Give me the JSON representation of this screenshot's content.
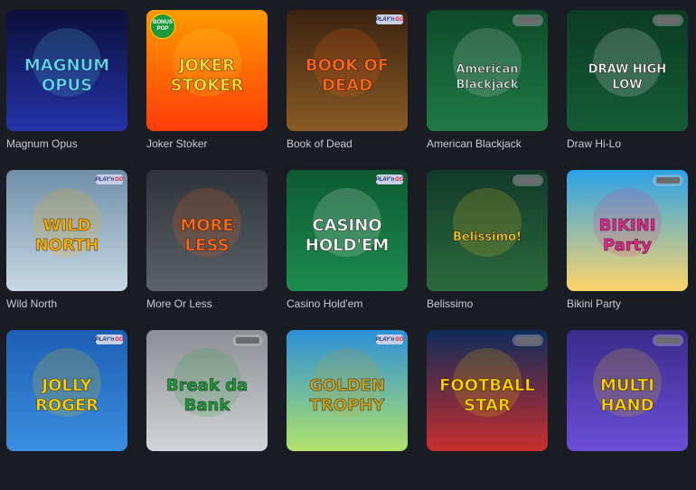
{
  "games": [
    {
      "title": "Magnum Opus",
      "art": "MAGNUM OPUS",
      "colors": [
        "#0b0f3a",
        "#2433a8"
      ],
      "accent": "#5fd7ff",
      "provider": "none"
    },
    {
      "title": "Joker Stoker",
      "art": "JOKER STOKER",
      "colors": [
        "#ff9a00",
        "#ff3b0a"
      ],
      "accent": "#ffde33",
      "provider": "bonus-pop"
    },
    {
      "title": "Book of Dead",
      "art": "BOOK OF DEAD",
      "colors": [
        "#3a2210",
        "#8a5b24"
      ],
      "accent": "#ff6a1a",
      "provider": "playngo"
    },
    {
      "title": "American Blackjack",
      "art": "American Blackjack",
      "colors": [
        "#0d4a2a",
        "#1f7a46"
      ],
      "accent": "#d9e8dc",
      "provider": "grey"
    },
    {
      "title": "Draw Hi-Lo",
      "art": "DRAW HIGH LOW",
      "colors": [
        "#0c3b24",
        "#145c36"
      ],
      "accent": "#ffffff",
      "provider": "grey"
    },
    {
      "title": "Wild North",
      "art": "WILD NORTH",
      "colors": [
        "#6f8fa8",
        "#c7d8e4"
      ],
      "accent": "#ffb000",
      "provider": "playngo"
    },
    {
      "title": "More Or Less",
      "art": "MORE LESS",
      "colors": [
        "#2e3338",
        "#5b6268"
      ],
      "accent": "#ff6b1a",
      "provider": "none"
    },
    {
      "title": "Casino Hold'em",
      "art": "CASINO HOLD'EM",
      "colors": [
        "#0d5a32",
        "#1c8c4e"
      ],
      "accent": "#ffffff",
      "provider": "playngo"
    },
    {
      "title": "Belissimo",
      "art": "Belissimo!",
      "colors": [
        "#123a2a",
        "#2b6a3c"
      ],
      "accent": "#ffd230",
      "provider": "grey"
    },
    {
      "title": "Bikini Party",
      "art": "BIKINI Party",
      "colors": [
        "#2aa2e8",
        "#ffd56b"
      ],
      "accent": "#e8268f",
      "provider": "grey"
    },
    {
      "title": "",
      "art": "JOLLY ROGER",
      "colors": [
        "#1d5fb5",
        "#3a8ee0"
      ],
      "accent": "#ffd200",
      "provider": "playngo"
    },
    {
      "title": "",
      "art": "Break da Bank",
      "colors": [
        "#8a8f94",
        "#d3d6d8"
      ],
      "accent": "#1f9b3a",
      "provider": "grey"
    },
    {
      "title": "",
      "art": "GOLDEN TROPHY",
      "colors": [
        "#2b8fd8",
        "#b2e36a"
      ],
      "accent": "#c9a227",
      "provider": "playngo"
    },
    {
      "title": "",
      "art": "FOOTBALL STAR",
      "colors": [
        "#0f2b5a",
        "#c82e2e"
      ],
      "accent": "#ffd200",
      "provider": "grey"
    },
    {
      "title": "",
      "art": "MULTI HAND",
      "colors": [
        "#3a2a8a",
        "#6b4fd8"
      ],
      "accent": "#ffd200",
      "provider": "grey"
    }
  ],
  "badge_text": {
    "play": "PLAY'n",
    "go": "GO",
    "bonus": "BONUS POP"
  }
}
